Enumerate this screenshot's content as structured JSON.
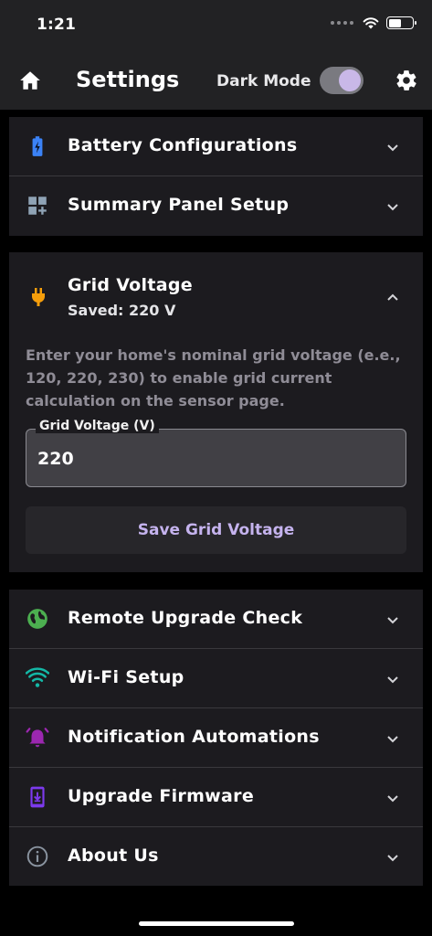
{
  "status_bar": {
    "time": "1:21"
  },
  "app_bar": {
    "title": "Settings",
    "dark_mode_label": "Dark Mode",
    "dark_mode_on": true
  },
  "sections_top": [
    {
      "label": "Battery Configurations",
      "icon": "battery-icon",
      "color": "#3b82f6"
    },
    {
      "label": "Summary Panel Setup",
      "icon": "dashboard-add-icon",
      "color": "#8fa3b5"
    }
  ],
  "grid_voltage": {
    "title": "Grid Voltage",
    "saved": "Saved: 220 V",
    "icon": "plug-icon",
    "icon_color": "#f59e0b",
    "description": "Enter your home's nominal grid voltage (e.e., 120, 220, 230) to enable grid current calculation on the sensor page.",
    "field_label": "Grid Voltage (V)",
    "field_value": "220",
    "save_label": "Save Grid Voltage"
  },
  "sections_bottom": [
    {
      "label": "Remote Upgrade Check",
      "icon": "globe-icon",
      "color": "#4caf50"
    },
    {
      "label": "Wi-Fi Setup",
      "icon": "wifi-icon",
      "color": "#14b8a6"
    },
    {
      "label": "Notification Automations",
      "icon": "alarm-bell-icon",
      "color": "#9c27b0"
    },
    {
      "label": "Upgrade Firmware",
      "icon": "phone-download-icon",
      "color": "#7c3aed"
    },
    {
      "label": "About Us",
      "icon": "info-icon",
      "color": "#8a94a0"
    }
  ]
}
